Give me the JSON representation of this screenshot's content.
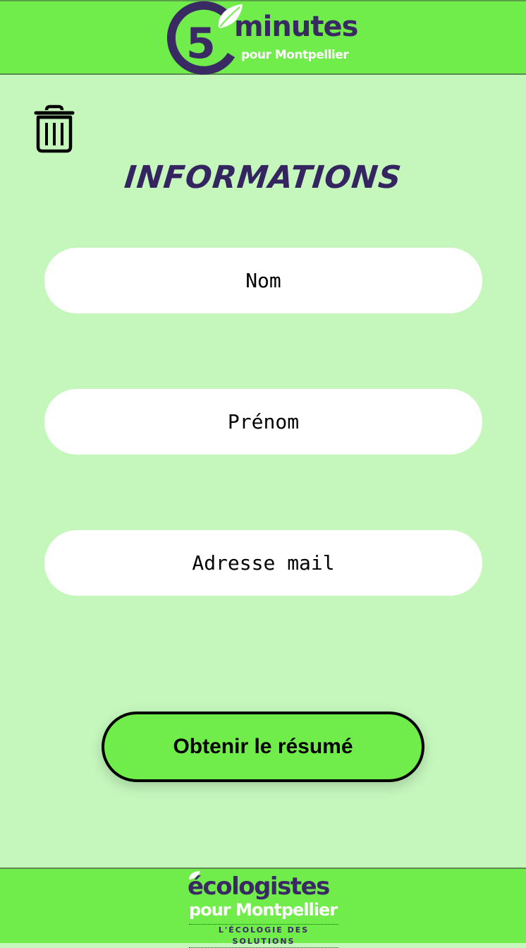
{
  "header": {
    "logo": {
      "number": "5",
      "word": "minutes",
      "subtitle": "pour Montpellier"
    }
  },
  "toolbar": {
    "delete_icon": "trash-icon"
  },
  "page": {
    "title": "INFORMATIONS"
  },
  "form": {
    "nom": {
      "placeholder": "Nom",
      "value": ""
    },
    "prenom": {
      "placeholder": "Prénom",
      "value": ""
    },
    "mail": {
      "placeholder": "Adresse mail",
      "value": ""
    },
    "submit_label": "Obtenir le résumé"
  },
  "footer": {
    "logo": {
      "line1": "écologistes",
      "line2": "pour Montpellier",
      "tagline": "L'ÉCOLOGIE DES SOLUTIONS"
    }
  },
  "colors": {
    "background": "#c5f7bd",
    "bar_green": "#70ec4b",
    "brand_purple": "#3a2a63",
    "white": "#ffffff"
  }
}
